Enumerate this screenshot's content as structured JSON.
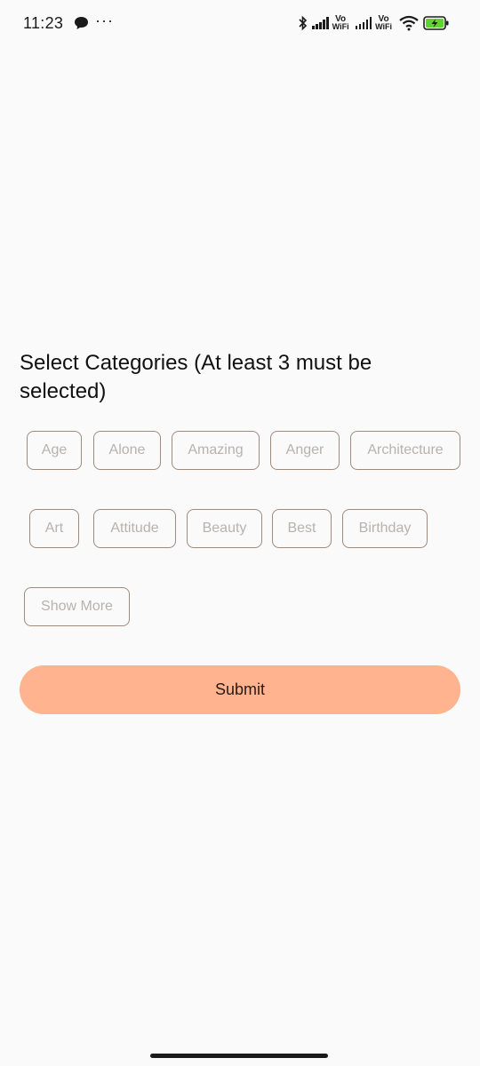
{
  "status_bar": {
    "time": "11:23",
    "dots": "···",
    "vo_label": "Vo",
    "wifi_label": "WiFi",
    "icons": [
      "chat-bubble-icon",
      "more-dots-icon",
      "bluetooth-icon",
      "signal-icon",
      "vowifi-icon",
      "signal-icon",
      "vowifi-icon",
      "wifi-icon",
      "battery-charging-icon"
    ],
    "battery_color": "#5fd32f"
  },
  "main": {
    "title": "Select Categories (At least 3 must be selected)",
    "categories_row1": [
      "Age",
      "Alone",
      "Amazing",
      "Anger",
      "Architecture"
    ],
    "categories_row2": [
      "Art",
      "Attitude",
      "Beauty",
      "Best",
      "Birthday"
    ],
    "show_more_label": "Show More",
    "submit_label": "Submit"
  },
  "colors": {
    "background": "#fafafa",
    "chip_border": "#a08a7d",
    "chip_text": "#b8b2ae",
    "submit_bg": "#ffb38f",
    "submit_text": "#2a1a12"
  }
}
